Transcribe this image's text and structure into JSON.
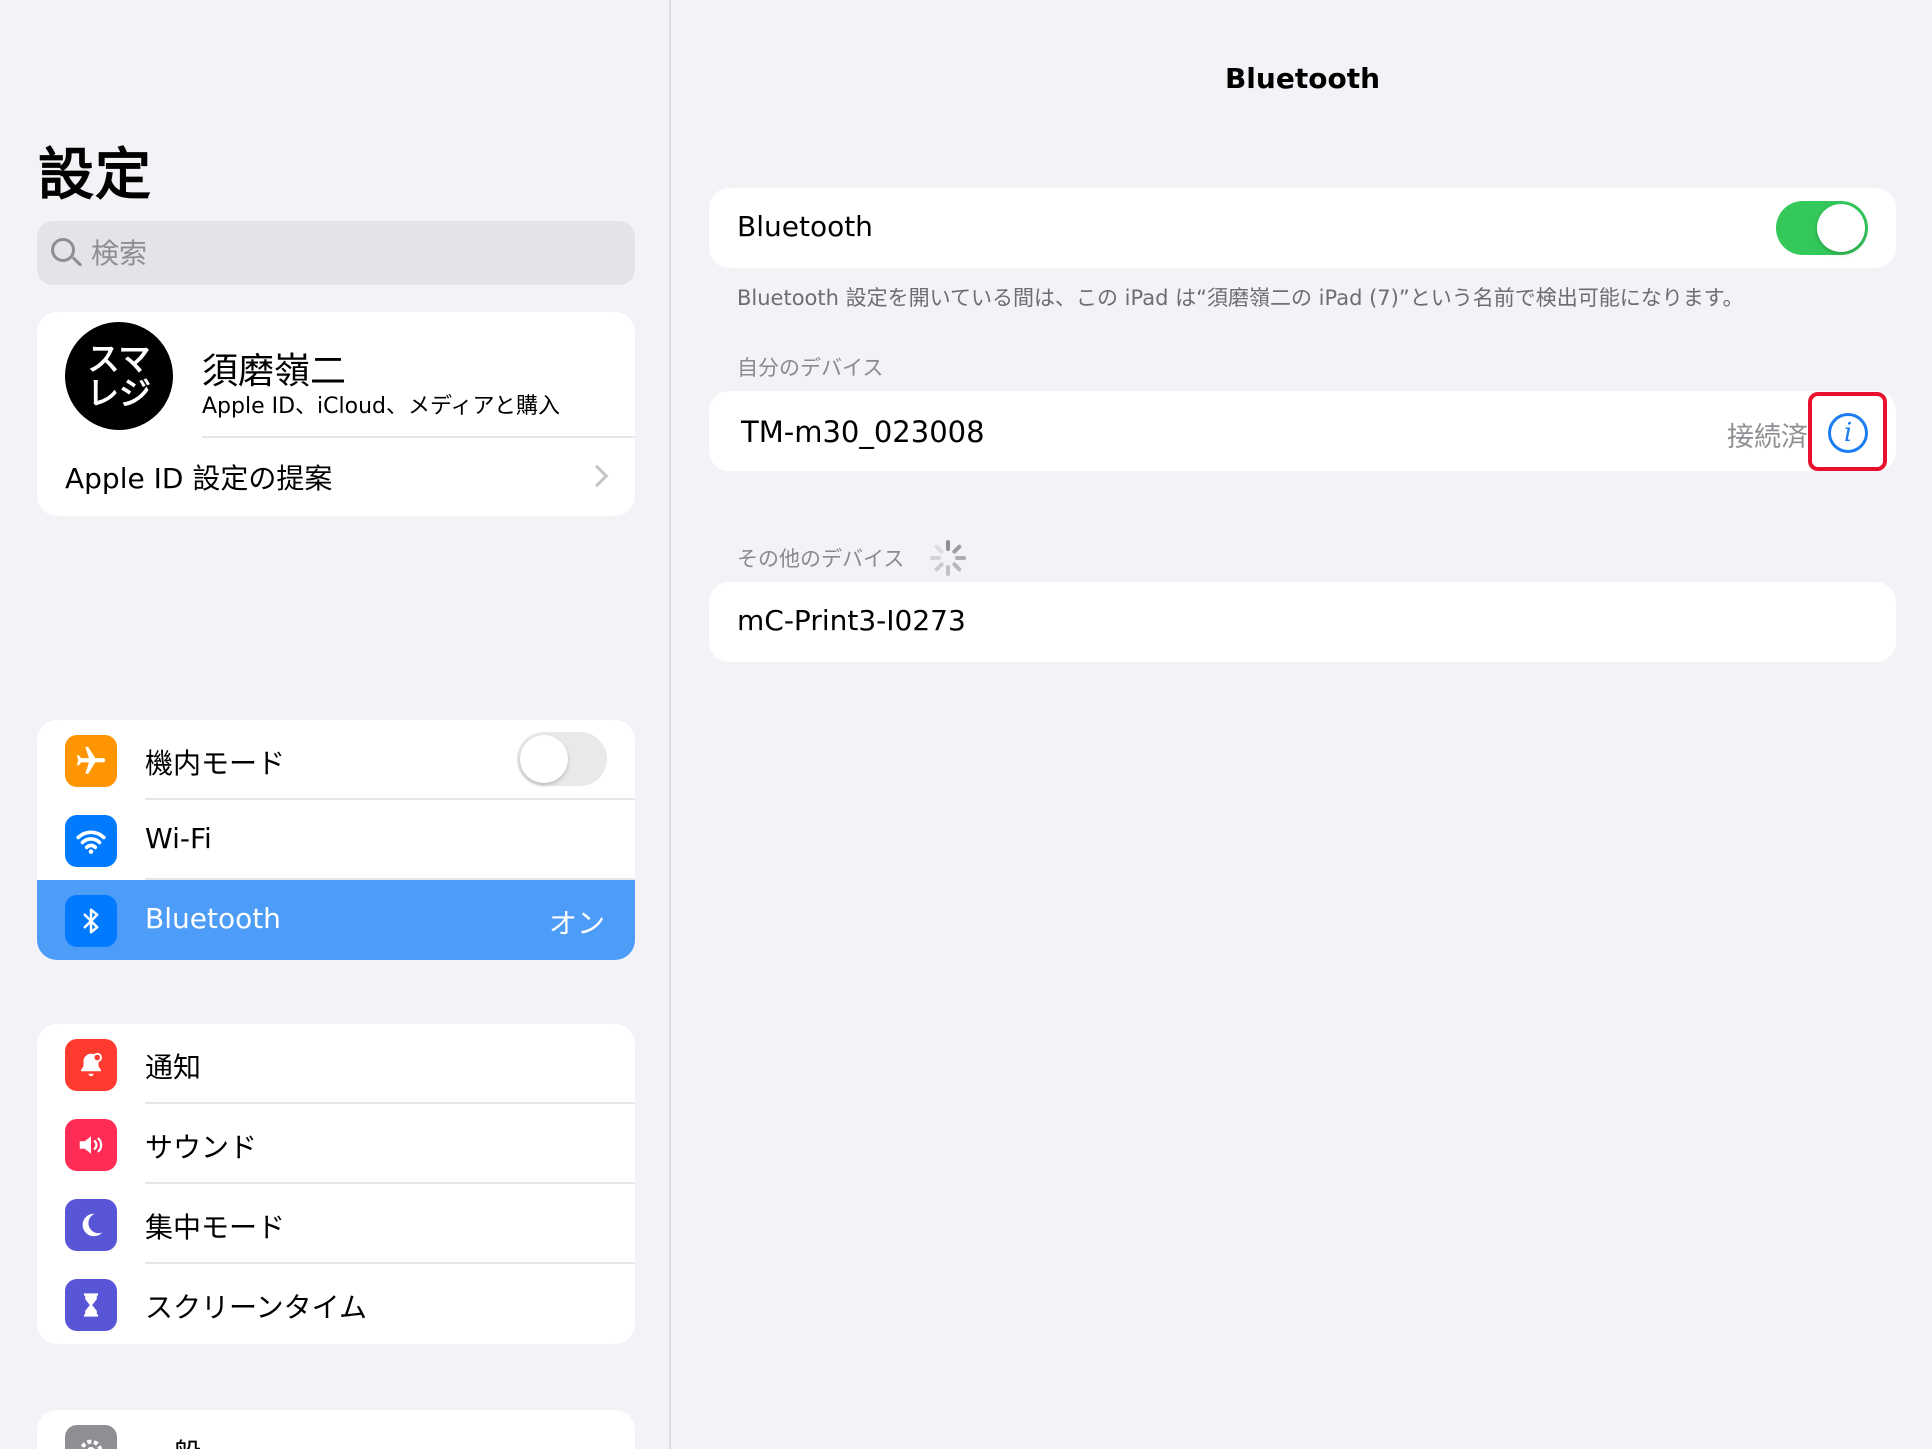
{
  "sidebar": {
    "title": "設定",
    "search": {
      "placeholder": "検索"
    },
    "profile": {
      "avatar_text": "スマレジ",
      "name": "須磨嶺二",
      "subtitle": "Apple ID、iCloud、メディアと購入",
      "suggestion": "Apple ID 設定の提案"
    },
    "groups": [
      {
        "items": [
          {
            "label": "機内モード",
            "icon": "airplane-icon",
            "color": "#ff9500",
            "toggle": false
          },
          {
            "label": "Wi-Fi",
            "icon": "wifi-icon",
            "color": "#007aff"
          },
          {
            "label": "Bluetooth",
            "icon": "bluetooth-icon",
            "color": "#007aff",
            "value": "オン",
            "selected": true
          }
        ]
      },
      {
        "items": [
          {
            "label": "通知",
            "icon": "bell-icon",
            "color": "#ff3b30"
          },
          {
            "label": "サウンド",
            "icon": "speaker-icon",
            "color": "#ff2d55"
          },
          {
            "label": "集中モード",
            "icon": "moon-icon",
            "color": "#5856d6"
          },
          {
            "label": "スクリーンタイム",
            "icon": "hourglass-icon",
            "color": "#5856d6"
          }
        ]
      },
      {
        "items": [
          {
            "label": "一般",
            "icon": "gear-icon",
            "color": "#8e8e93"
          }
        ]
      }
    ]
  },
  "detail": {
    "title": "Bluetooth",
    "toggle_label": "Bluetooth",
    "toggle_on": true,
    "footnote": "Bluetooth 設定を開いている間は、この iPad は“須磨嶺二の iPad (7)”という名前で検出可能になります。",
    "my_devices_header": "自分のデバイス",
    "my_devices": [
      {
        "name": "TM-m30_023008",
        "status": "接続済"
      }
    ],
    "other_devices_header": "その他のデバイス",
    "other_devices": [
      {
        "name": "mC-Print3-I0273"
      }
    ]
  },
  "colors": {
    "accent": "#007aff",
    "toggle_on": "#34c759",
    "selected_row": "#4d9cf8",
    "highlight": "#e8112d"
  }
}
